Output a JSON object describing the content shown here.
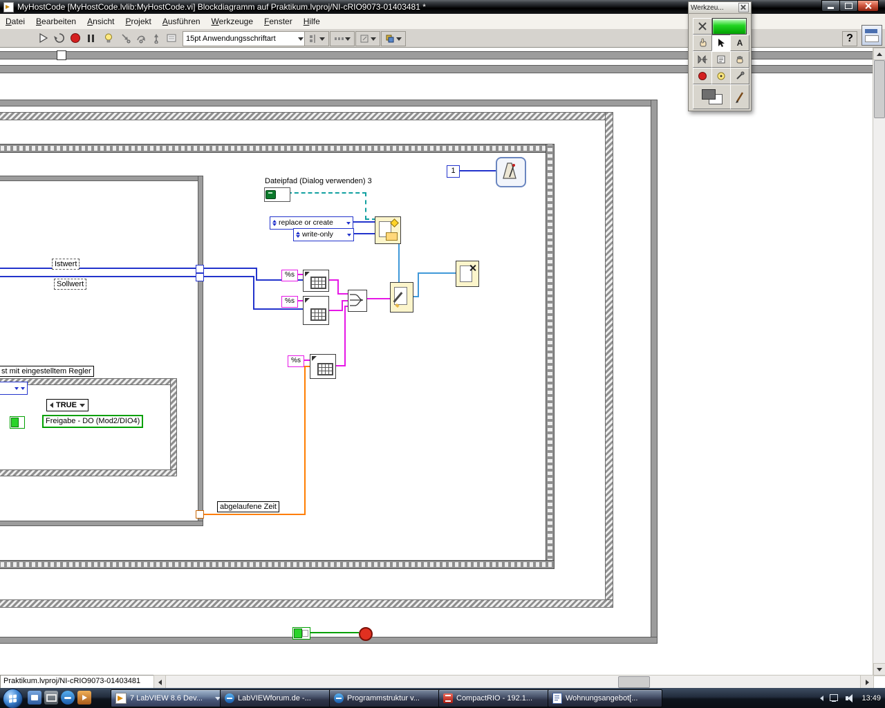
{
  "titlebar": {
    "title": "MyHostCode [MyHostCode.lvlib:MyHostCode.vi] Blockdiagramm auf Praktikum.lvproj/NI-cRIO9073-01403481 *"
  },
  "menubar": {
    "items": [
      "Datei",
      "Bearbeiten",
      "Ansicht",
      "Projekt",
      "Ausführen",
      "Werkzeuge",
      "Fenster",
      "Hilfe"
    ]
  },
  "toolbar": {
    "font_selector": "15pt Anwendungsschriftart",
    "help_label": "?"
  },
  "tools_palette": {
    "title": "Werkzeu...",
    "edit_text_glyph": "A",
    "tools": [
      "automatic-tool-selection",
      "auto-select-led",
      "operate-value-tool",
      "position-select-tool",
      "edit-text-tool",
      "connect-wire-tool",
      "object-shortcut-menu-tool",
      "scroll-window-tool",
      "breakpoint-tool",
      "probe-tool",
      "get-color-tool",
      "color-boxes",
      "set-color-tool"
    ]
  },
  "diagram": {
    "labels": {
      "istwert": "Istwert",
      "sollwert": "Sollwert",
      "regler": "st mit eingestelltem Regler",
      "dateipfad": "Dateipfad (Dialog verwenden) 3",
      "abgelaufene_zeit": "abgelaufene Zeit",
      "freigabe": "Freigabe - DO (Mod2/DIO4)"
    },
    "constants": {
      "replace_or_create": "replace or create",
      "write_only": "write-only",
      "case_selector": "TRUE",
      "wait_ms": "1",
      "format_spec": "%s"
    }
  },
  "bottombar": {
    "context_label": "Praktikum.lvproj/NI-cRIO9073-01403481"
  },
  "taskbar": {
    "tasks": [
      "7 LabVIEW 8.6 Dev...",
      "LabVIEWforum.de -...",
      "Programmstruktur v...",
      "CompactRIO - 192.1...",
      "Wohnungsangebot[..."
    ],
    "clock": "13:49"
  },
  "colors": {
    "wire_integer": "#2233cc",
    "wire_string": "#e617e6",
    "wire_path": "#11a0a0",
    "wire_refnum": "#3f98d8",
    "wire_numeric": "#ff7d00",
    "wire_boolean": "#00a000",
    "node_bg": "#fcf5cb",
    "led_green": "#22d422",
    "abort_red": "#d42020"
  }
}
